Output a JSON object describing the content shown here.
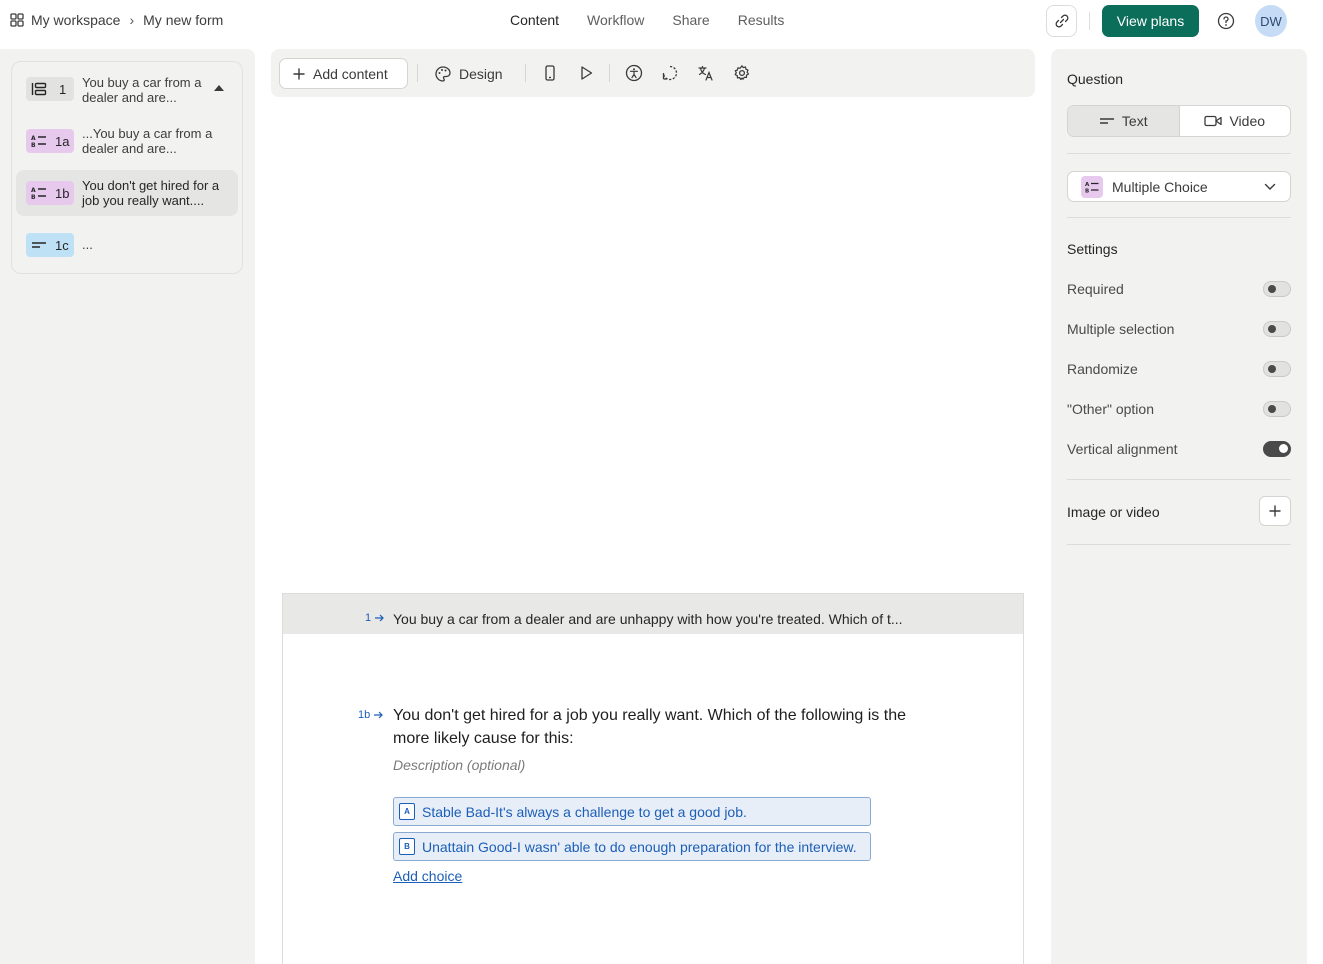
{
  "breadcrumb": {
    "workspace": "My workspace",
    "separator": "›",
    "form": "My new form"
  },
  "nav": {
    "tabs": [
      "Content",
      "Workflow",
      "Share",
      "Results"
    ],
    "active": "Content"
  },
  "header": {
    "view_plans": "View plans",
    "avatar": "DW"
  },
  "toolbar": {
    "add_content": "Add content",
    "design": "Design"
  },
  "sidebar": {
    "items": [
      {
        "badge": "1",
        "text": "You buy a car from a dealer and are...",
        "type": "group",
        "color": "#e2e2e0"
      },
      {
        "badge": "1a",
        "text": "...You buy a car from a dealer and are...",
        "type": "multiple-choice",
        "color": "#e7c9ee"
      },
      {
        "badge": "1b",
        "text": "You don't get hired for a job you really want....",
        "type": "multiple-choice",
        "color": "#e7c9ee",
        "selected": true
      },
      {
        "badge": "1c",
        "text": "...",
        "type": "short-text",
        "color": "#bfe1f6"
      }
    ]
  },
  "preview": {
    "prev_number": "1",
    "prev_text": "You buy a car from a dealer and are unhappy with how you're treated. Which of t...",
    "current_number": "1b",
    "current_title": "You don't get hired for a job you really want. Which of the following is the more likely cause for this:",
    "description_placeholder": "Description (optional)",
    "choices": [
      {
        "key": "A",
        "label": "Stable Bad-It's always a challenge to get a good job."
      },
      {
        "key": "B",
        "label": "Unattain Good-I wasn' able to do enough preparation for the interview."
      }
    ],
    "add_choice": "Add choice"
  },
  "right_panel": {
    "question_heading": "Question",
    "format_options": [
      "Text",
      "Video"
    ],
    "format_active": "Text",
    "question_type": "Multiple Choice",
    "settings_heading": "Settings",
    "settings": [
      {
        "label": "Required",
        "on": false
      },
      {
        "label": "Multiple selection",
        "on": false
      },
      {
        "label": "Randomize",
        "on": false
      },
      {
        "label": "\"Other\" option",
        "on": false
      },
      {
        "label": "Vertical alignment",
        "on": true
      }
    ],
    "media_heading": "Image or video"
  },
  "colors": {
    "accent": "#0b6e5a",
    "link": "#1c5fb8",
    "panel_bg": "#f2f2f1"
  }
}
